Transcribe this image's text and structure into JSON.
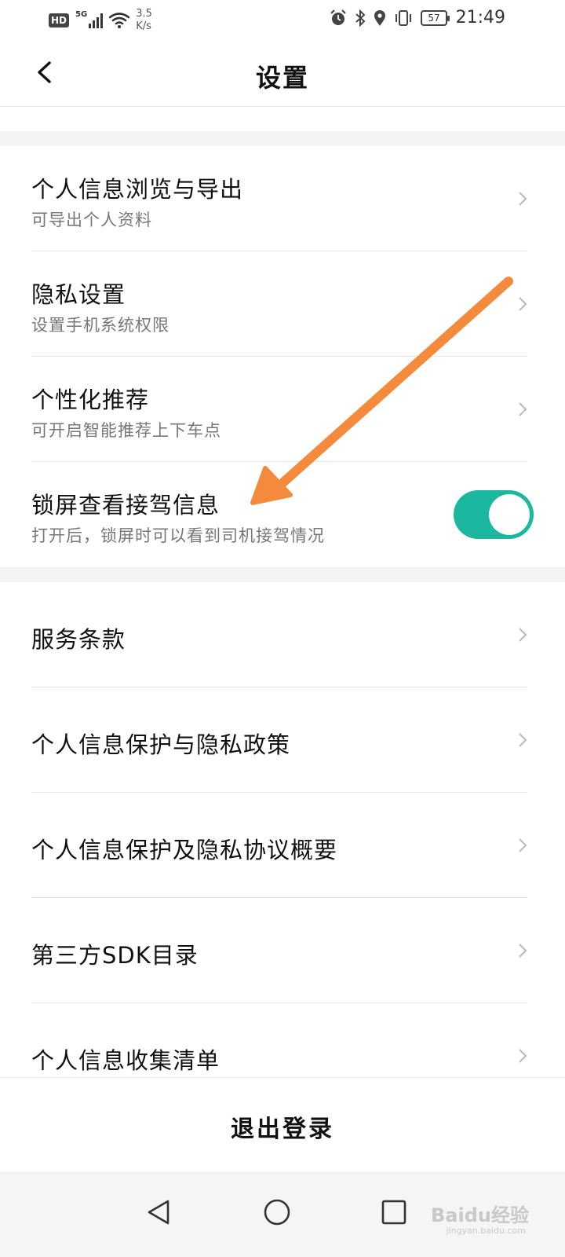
{
  "status_bar": {
    "hd": "HD",
    "network": "5G",
    "speed_value": "3.5",
    "speed_unit": "K/s",
    "battery": "57",
    "time": "21:49"
  },
  "header": {
    "title": "设置",
    "back_icon": "chevron-left-icon"
  },
  "section1": [
    {
      "title": "个人信息浏览与导出",
      "subtitle": "可导出个人资料"
    },
    {
      "title": "隐私设置",
      "subtitle": "设置手机系统权限"
    },
    {
      "title": "个性化推荐",
      "subtitle": "可开启智能推荐上下车点"
    },
    {
      "title": "锁屏查看接驾信息",
      "subtitle": "打开后，锁屏时可以看到司机接驾情况",
      "toggle_on": true
    }
  ],
  "section2": [
    {
      "title": "服务条款"
    },
    {
      "title": "个人信息保护与隐私政策"
    },
    {
      "title": "个人信息保护及隐私协议概要"
    },
    {
      "title": "第三方SDK目录"
    },
    {
      "title": "个人信息收集清单"
    }
  ],
  "logout": "退出登录",
  "watermark": {
    "brand": "Baidu经验",
    "url": "jingyan.baidu.com"
  },
  "colors": {
    "toggle_on": "#1bb79e",
    "annotation_arrow": "#f48a3c"
  }
}
